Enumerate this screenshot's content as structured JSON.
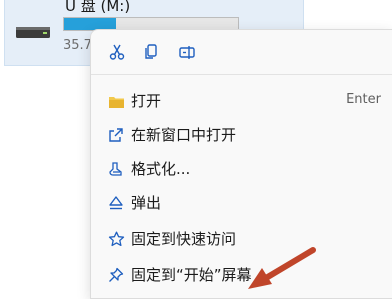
{
  "drive": {
    "name": "U 盘 (M:)",
    "space_text": "35.7",
    "usage_fraction": 0.3
  },
  "context_menu": {
    "quick_actions": [
      {
        "icon": "cut-icon"
      },
      {
        "icon": "copy-icon"
      },
      {
        "icon": "rename-icon"
      }
    ],
    "items": [
      {
        "label": "打开",
        "shortcut": "Enter",
        "icon": "folder-icon"
      },
      {
        "label": "在新窗口中打开",
        "icon": "open-new-window-icon"
      },
      {
        "label": "格式化...",
        "icon": "format-icon"
      },
      {
        "label": "弹出",
        "icon": "eject-icon"
      },
      {
        "label": "固定到快速访问",
        "icon": "star-icon"
      },
      {
        "label": "固定到“开始”屏幕",
        "icon": "pin-icon"
      }
    ]
  },
  "colors": {
    "accent": "#26a0da",
    "icon_blue": "#1f5fbf",
    "arrow": "#c0452a"
  }
}
